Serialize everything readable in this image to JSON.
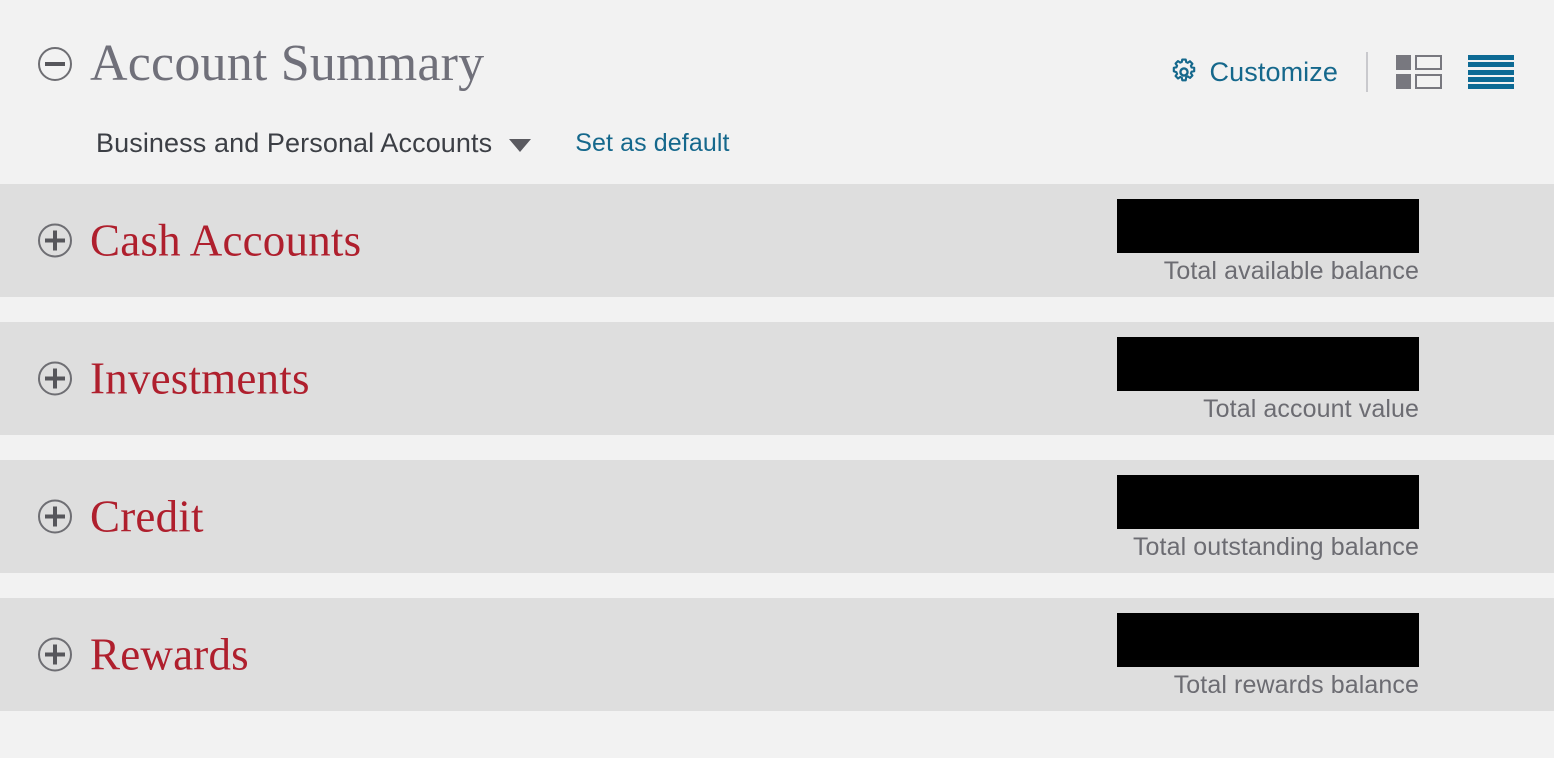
{
  "header": {
    "collapse_icon": "minus-circle-icon",
    "title": "Account Summary",
    "account_filter": {
      "value": "Business and Personal Accounts",
      "caret_icon": "chevron-down-icon"
    },
    "set_as_default_label": "Set as default",
    "customize": {
      "icon": "gear-icon",
      "label": "Customize"
    },
    "view_toggles": [
      {
        "name": "card-view-icon",
        "selected": false,
        "color": "#78787f"
      },
      {
        "name": "list-view-icon",
        "selected": true,
        "color": "#0d6a94"
      }
    ]
  },
  "colors": {
    "page_background": "#f2f2f2",
    "row_background": "#dedede",
    "section_title": "#af1f2d",
    "link": "#15688c",
    "title_gray": "#70707a",
    "label_gray": "#6c6c72",
    "redaction": "#000000"
  },
  "sections": [
    {
      "expand_icon": "plus-circle-icon",
      "name": "Cash Accounts",
      "amount": "",
      "amount_redacted": true,
      "balance_label": "Total available balance"
    },
    {
      "expand_icon": "plus-circle-icon",
      "name": "Investments",
      "amount": "",
      "amount_redacted": true,
      "balance_label": "Total account value"
    },
    {
      "expand_icon": "plus-circle-icon",
      "name": "Credit",
      "amount": "",
      "amount_redacted": true,
      "balance_label": "Total outstanding balance"
    },
    {
      "expand_icon": "plus-circle-icon",
      "name": "Rewards",
      "amount": "",
      "amount_redacted": true,
      "balance_label": "Total rewards balance"
    }
  ]
}
